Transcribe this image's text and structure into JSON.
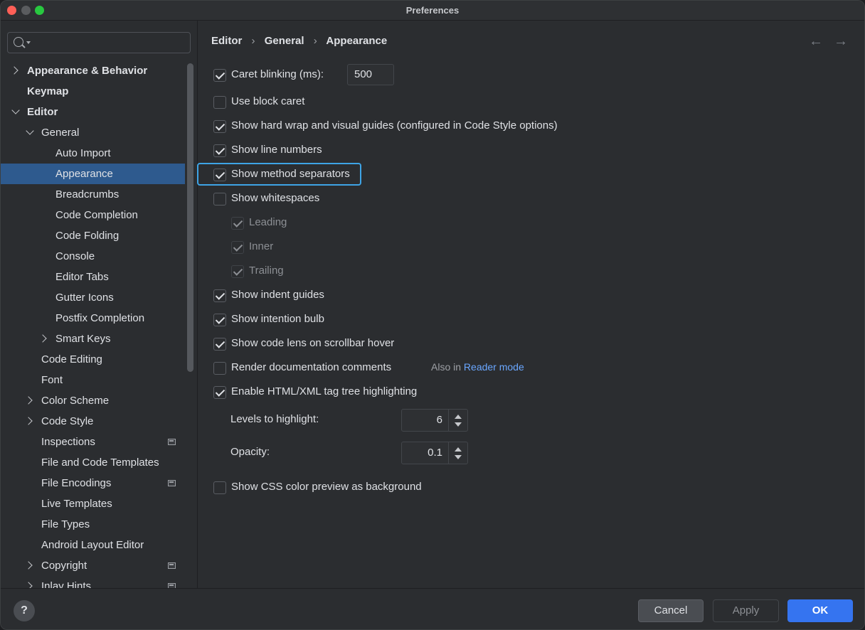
{
  "window": {
    "title": "Preferences"
  },
  "sidebar": {
    "search": {
      "placeholder": "",
      "value": ""
    },
    "items": [
      {
        "label": "Appearance & Behavior",
        "level": 0,
        "bold": true,
        "chevron": "right"
      },
      {
        "label": "Keymap",
        "level": 0,
        "bold": true
      },
      {
        "label": "Editor",
        "level": 0,
        "bold": true,
        "chevron": "down"
      },
      {
        "label": "General",
        "level": 1,
        "chevron": "down"
      },
      {
        "label": "Auto Import",
        "level": 2
      },
      {
        "label": "Appearance",
        "level": 2,
        "selected": true
      },
      {
        "label": "Breadcrumbs",
        "level": 2
      },
      {
        "label": "Code Completion",
        "level": 2
      },
      {
        "label": "Code Folding",
        "level": 2
      },
      {
        "label": "Console",
        "level": 2
      },
      {
        "label": "Editor Tabs",
        "level": 2
      },
      {
        "label": "Gutter Icons",
        "level": 2
      },
      {
        "label": "Postfix Completion",
        "level": 2
      },
      {
        "label": "Smart Keys",
        "level": 2,
        "chevron": "right"
      },
      {
        "label": "Code Editing",
        "level": 1
      },
      {
        "label": "Font",
        "level": 1
      },
      {
        "label": "Color Scheme",
        "level": 1,
        "chevron": "right"
      },
      {
        "label": "Code Style",
        "level": 1,
        "chevron": "right"
      },
      {
        "label": "Inspections",
        "level": 1,
        "project_icon": true
      },
      {
        "label": "File and Code Templates",
        "level": 1
      },
      {
        "label": "File Encodings",
        "level": 1,
        "project_icon": true
      },
      {
        "label": "Live Templates",
        "level": 1
      },
      {
        "label": "File Types",
        "level": 1
      },
      {
        "label": "Android Layout Editor",
        "level": 1
      },
      {
        "label": "Copyright",
        "level": 1,
        "chevron": "right",
        "project_icon": true
      },
      {
        "label": "Inlay Hints",
        "level": 1,
        "chevron": "right",
        "project_icon": true
      }
    ]
  },
  "content": {
    "breadcrumb": [
      "Editor",
      "General",
      "Appearance"
    ],
    "breadcrumb_sep": "›",
    "nav": {
      "back": "←",
      "forward": "→"
    },
    "caret_blinking": {
      "label": "Caret blinking (ms):",
      "checked": true,
      "value": "500"
    },
    "options": [
      {
        "label": "Use block caret",
        "checked": false
      },
      {
        "label": "Show hard wrap and visual guides (configured in Code Style options)",
        "checked": true
      },
      {
        "label": "Show line numbers",
        "checked": true
      },
      {
        "label": "Show method separators",
        "checked": true,
        "focused": true
      },
      {
        "label": "Show whitespaces",
        "checked": false
      },
      {
        "label": "Leading",
        "checked": true,
        "sub": true,
        "disabled": true
      },
      {
        "label": "Inner",
        "checked": true,
        "sub": true,
        "disabled": true
      },
      {
        "label": "Trailing",
        "checked": true,
        "sub": true,
        "disabled": true
      },
      {
        "label": "Show indent guides",
        "checked": true
      },
      {
        "label": "Show intention bulb",
        "checked": true
      },
      {
        "label": "Show code lens on scrollbar hover",
        "checked": true
      },
      {
        "label": "Render documentation comments",
        "checked": false
      },
      {
        "label": "Enable HTML/XML tag tree highlighting",
        "checked": true
      }
    ],
    "also_in": {
      "prefix": "Also in",
      "link": "Reader mode"
    },
    "levels": {
      "label": "Levels to highlight:",
      "value": "6"
    },
    "opacity": {
      "label": "Opacity:",
      "value": "0.1"
    },
    "css_preview": {
      "label": "Show CSS color preview as background",
      "checked": false
    }
  },
  "footer": {
    "help": "?",
    "cancel": "Cancel",
    "apply": "Apply",
    "ok": "OK"
  },
  "colors": {
    "accent": "#3574f0",
    "selection": "#2e5a8e",
    "focus_ring": "#3ea4e6",
    "link": "#6aa7ff"
  }
}
